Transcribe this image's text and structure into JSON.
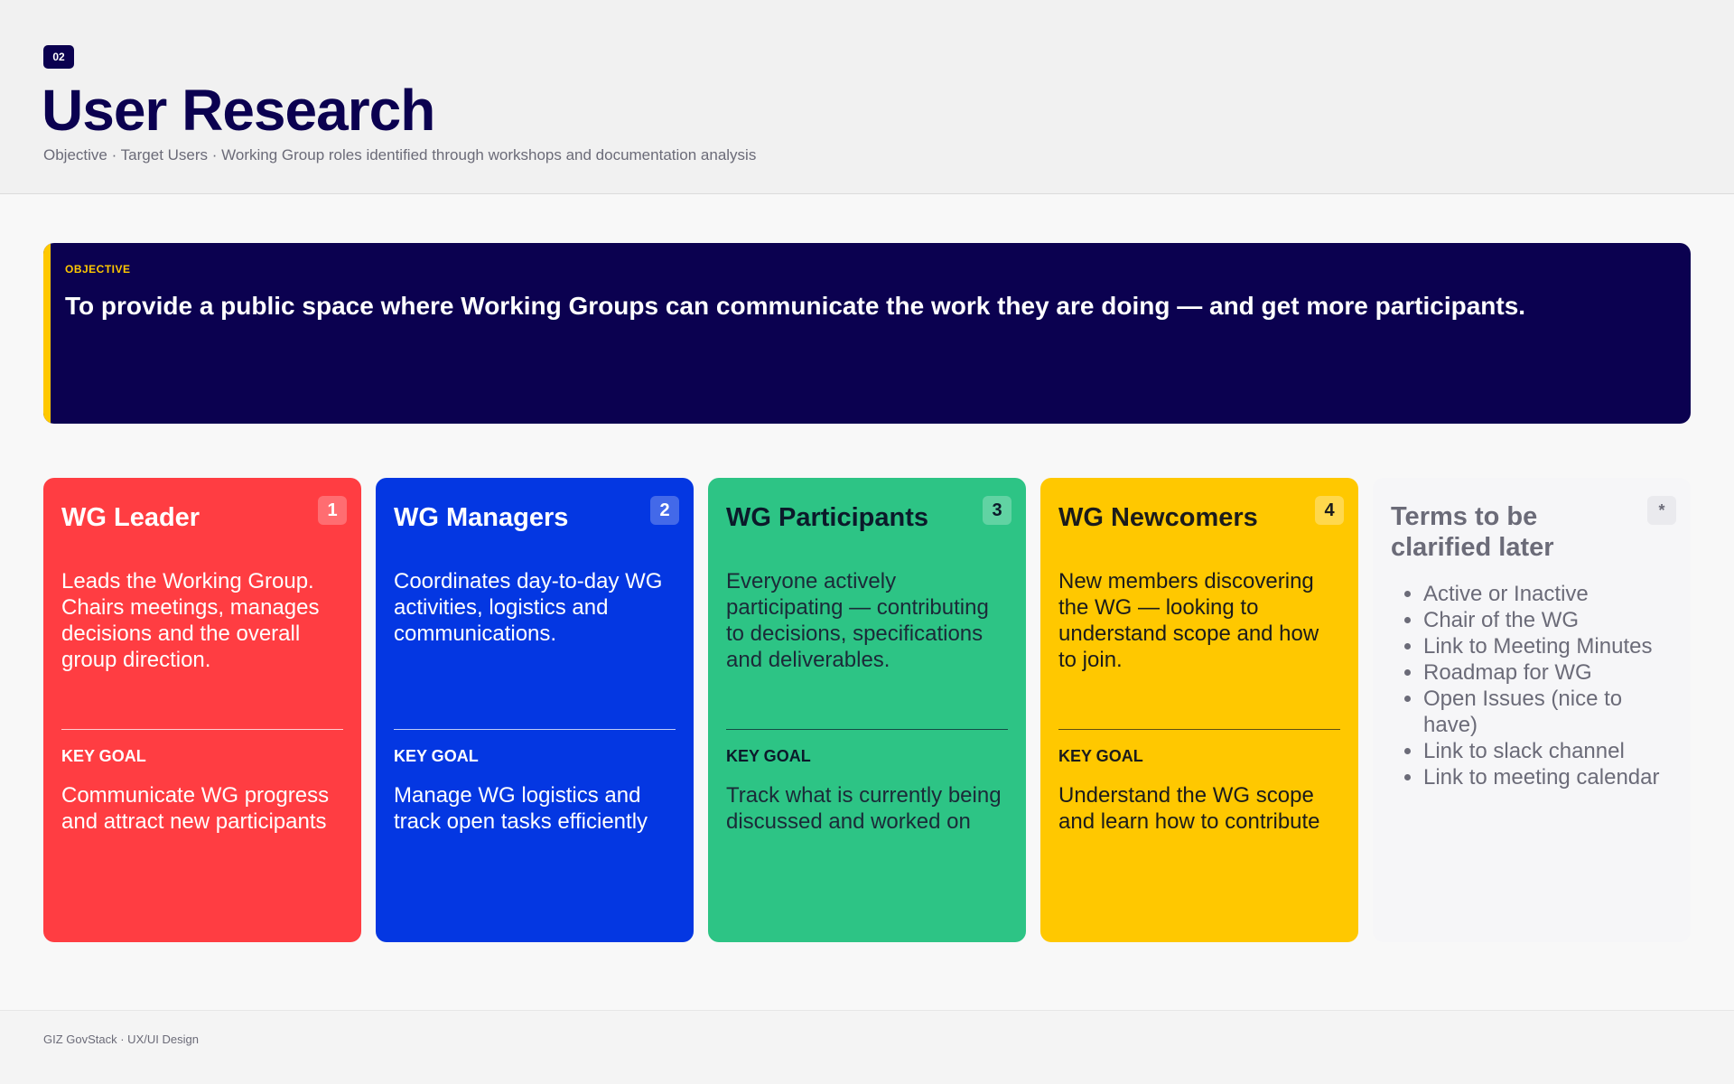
{
  "header": {
    "badge": "02",
    "title": "User Research",
    "subtitle": "Objective · Target Users · Working Group roles identified through workshops and documentation analysis"
  },
  "objective": {
    "label": "OBJECTIVE",
    "text": "To provide a public space where Working Groups can communicate the work they are doing — and get more participants.",
    "accent_color": "#ffc800",
    "background_color": "#0b0150"
  },
  "cards": [
    {
      "number": "1",
      "name": "WG Leader",
      "description": "Leads the Working Group. Chairs meetings, manages decisions and the overall group direction.",
      "goal_label": "KEY GOAL",
      "goal": "Communicate WG progress and attract new participants",
      "color": "#ff3d42"
    },
    {
      "number": "2",
      "name": "WG Managers",
      "description": "Coordinates day-to-day WG activities, logistics and communications.",
      "goal_label": "KEY GOAL",
      "goal": "Manage WG logistics and track open tasks efficiently",
      "color": "#0437e2"
    },
    {
      "number": "3",
      "name": "WG Participants",
      "description": "Everyone actively participating — contributing to decisions, specifications and deliverables.",
      "goal_label": "KEY GOAL",
      "goal": "Track what is currently being discussed and worked on",
      "color": "#2dc485"
    },
    {
      "number": "4",
      "name": "WG Newcomers",
      "description": "New members discovering the WG — looking to understand scope and how to join.",
      "goal_label": "KEY GOAL",
      "goal": "Understand the WG scope and learn how to contribute",
      "color": "#ffc800"
    }
  ],
  "terms": {
    "number": "*",
    "title": "Terms to be clarified later",
    "items": [
      "Active or Inactive",
      "Chair of the WG",
      "Link to Meeting Minutes",
      "Roadmap for WG",
      "Open Issues (nice to have)",
      "Link to slack channel",
      "Link to meeting calendar"
    ]
  },
  "footer": {
    "text": "GIZ GovStack  ·  UX/UI Design"
  }
}
